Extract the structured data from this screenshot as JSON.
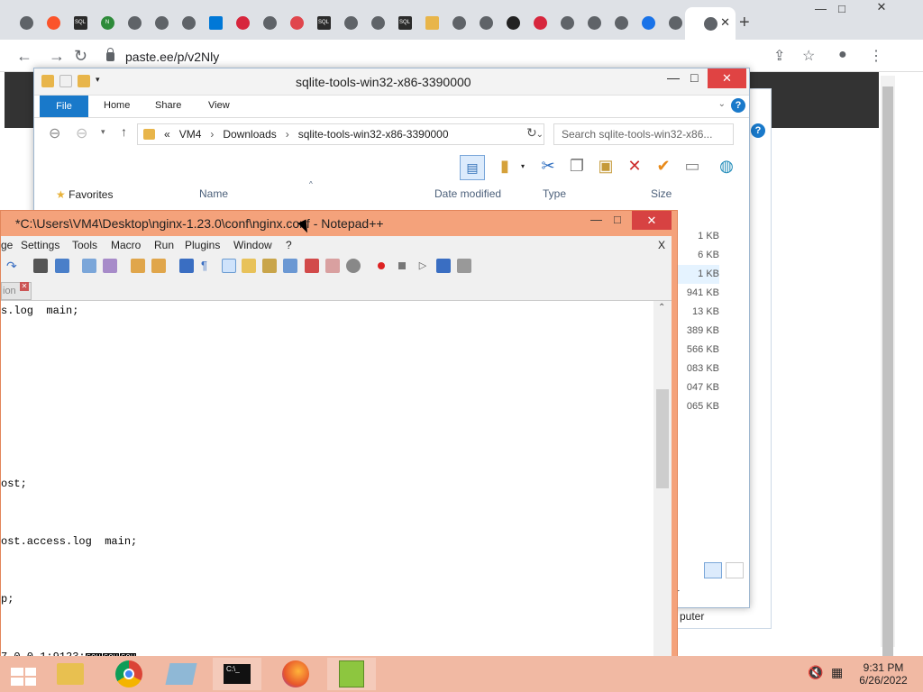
{
  "browser": {
    "url": "paste.ee/p/v2Nly",
    "tabs": [
      {
        "icon": "chrome-icon"
      },
      {
        "icon": "brave-icon"
      },
      {
        "icon": "sqlite-icon",
        "label": "SQL"
      },
      {
        "icon": "node-icon",
        "label": "N"
      },
      {
        "icon": "download-icon"
      },
      {
        "icon": "chrome-icon"
      },
      {
        "icon": "chrome-icon"
      },
      {
        "icon": "windows-icon"
      },
      {
        "icon": "opera-icon"
      },
      {
        "icon": "chrome-icon"
      },
      {
        "icon": "pdf-icon"
      },
      {
        "icon": "sqlite-icon",
        "label": "SQL"
      },
      {
        "icon": "chrome-icon"
      },
      {
        "icon": "diamond-icon"
      },
      {
        "icon": "sqlite-icon",
        "label": "SQL"
      },
      {
        "icon": "folder-icon"
      },
      {
        "icon": "gear-icon"
      },
      {
        "icon": "chrome-icon"
      },
      {
        "icon": "wikipedia-icon"
      },
      {
        "icon": "opera-icon"
      },
      {
        "icon": "chrome-icon"
      },
      {
        "icon": "chrome-icon"
      },
      {
        "icon": "gear-icon"
      },
      {
        "icon": "cloud-icon"
      },
      {
        "icon": "chrome-icon"
      }
    ]
  },
  "explorer": {
    "title": "sqlite-tools-win32-x86-3390000",
    "ribbon_tabs": [
      "File",
      "Home",
      "Share",
      "View"
    ],
    "breadcrumb": [
      "«",
      "VM4",
      "Downloads",
      "sqlite-tools-win32-x86-3390000"
    ],
    "search_placeholder": "Search sqlite-tools-win32-x86...",
    "columns": [
      "Name",
      "Date modified",
      "Type",
      "Size"
    ],
    "favorites": "Favorites",
    "sizes": [
      "1 KB",
      "6 KB",
      "1 KB",
      "941 KB",
      "13 KB",
      "389 KB",
      "566 KB",
      "083 KB",
      "047 KB",
      "065 KB"
    ],
    "status_r": "r",
    "computer_label": "puter"
  },
  "notepad": {
    "title": "*C:\\Users\\VM4\\Desktop\\nginx-1.23.0\\conf\\nginx.conf - Notepad++",
    "menu": [
      "ge",
      "Settings",
      "Tools",
      "Macro",
      "Run",
      "Plugins",
      "Window",
      "?"
    ],
    "close_x": "X",
    "tab_label": "ion",
    "lines": [
      "s.log  main;",
      "ost;",
      "ost.access.log  main;",
      "p;"
    ],
    "soh_line_prefix": "7.0.0.1:9123:",
    "soh_tokens": [
      "SOH",
      "SOH",
      "SOH"
    ]
  },
  "taskbar": {
    "time": "9:31 PM",
    "date": "6/26/2022"
  }
}
